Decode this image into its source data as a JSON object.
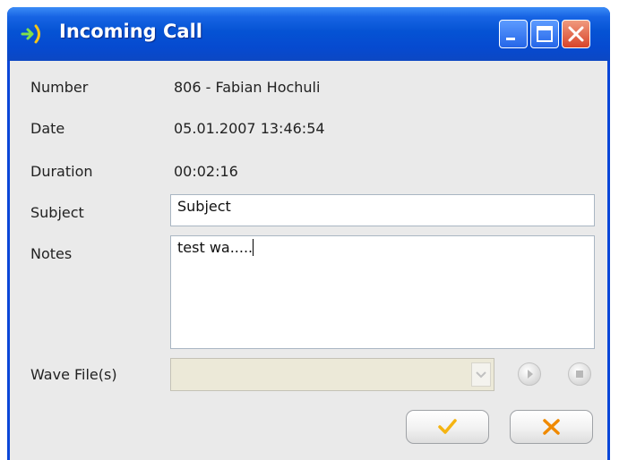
{
  "window": {
    "title": "Incoming Call",
    "controls": [
      "minimize-icon",
      "maximize-icon",
      "close-icon"
    ]
  },
  "fields": {
    "number_label": "Number",
    "number_value": "806 - Fabian Hochuli",
    "date_label": "Date",
    "date_value": "05.01.2007 13:46:54",
    "duration_label": "Duration",
    "duration_value": "00:02:16",
    "subject_label": "Subject",
    "subject_value": "Subject",
    "notes_label": "Notes",
    "notes_value": "test wa.....",
    "wave_label": "Wave File(s)",
    "wave_value": ""
  },
  "buttons": {
    "play_icon": "play-icon",
    "stop_icon": "stop-icon",
    "ok_icon": "checkmark-icon",
    "cancel_icon": "x-icon"
  },
  "colors": {
    "titlebar": "#0553d4",
    "client_bg": "#eaeaea",
    "ok_accent": "#f5b412",
    "cancel_accent": "#f08a00"
  }
}
